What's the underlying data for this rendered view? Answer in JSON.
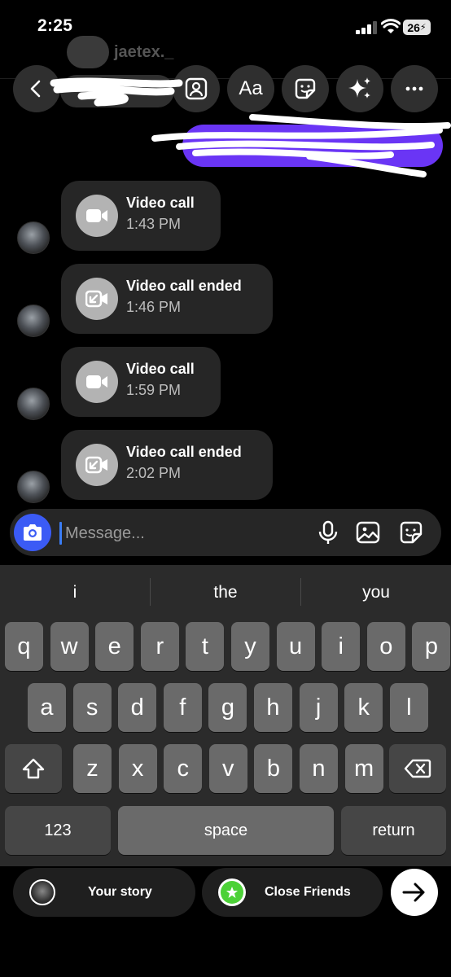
{
  "status_bar": {
    "time": "2:25",
    "battery": "26"
  },
  "header": {
    "username_partial": "jaetex._"
  },
  "toolbar": {
    "text_style_label": "Aa"
  },
  "messages": [
    {
      "title": "Video call",
      "time": "1:43 PM",
      "icon": "video-camera-icon"
    },
    {
      "title": "Video call ended",
      "time": "1:46 PM",
      "icon": "video-call-ended-icon"
    },
    {
      "title": "Video call",
      "time": "1:59 PM",
      "icon": "video-camera-icon"
    },
    {
      "title": "Video call ended",
      "time": "2:02 PM",
      "icon": "video-call-ended-icon"
    }
  ],
  "composer": {
    "placeholder": "Message..."
  },
  "keyboard": {
    "suggestions": [
      "i",
      "the",
      "you"
    ],
    "row1": [
      "q",
      "w",
      "e",
      "r",
      "t",
      "y",
      "u",
      "i",
      "o",
      "p"
    ],
    "row2": [
      "a",
      "s",
      "d",
      "f",
      "g",
      "h",
      "j",
      "k",
      "l"
    ],
    "row3": [
      "z",
      "x",
      "c",
      "v",
      "b",
      "n",
      "m"
    ],
    "numbers_label": "123",
    "space_label": "space",
    "return_label": "return"
  },
  "share_bar": {
    "your_story_label": "Your story",
    "close_friends_label": "Close Friends"
  },
  "colors": {
    "accent_blue": "#3b5bf5",
    "outgoing_bubble": "#6a35f5",
    "close_friends_green": "#4cd137"
  }
}
